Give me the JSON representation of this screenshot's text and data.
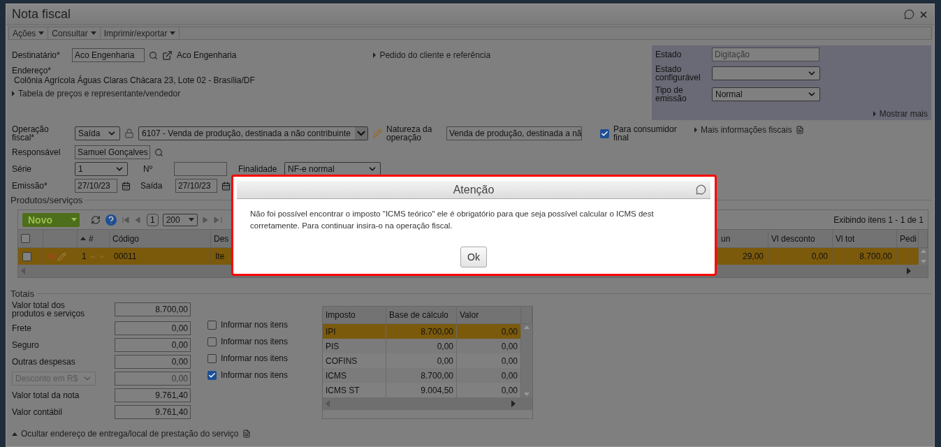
{
  "window": {
    "title": "Nota fiscal"
  },
  "menu": [
    {
      "label": "Ações"
    },
    {
      "label": "Consultar"
    },
    {
      "label": "Imprimir/exportar"
    }
  ],
  "destinatario": {
    "label": "Destinatário*",
    "value": "Aco Engenharia",
    "link": "Aco Engenharia"
  },
  "pedido_link": "Pedido do cliente e referência",
  "endereco": {
    "label": "Endereço*",
    "value": "Colônia Agrícola Águas Claras Chácara 23, Lote 02 - Brasília/DF"
  },
  "tabela_link": "Tabela de preços e representante/vendedor",
  "status_panel": {
    "estado": {
      "label": "Estado",
      "value": "Digitação"
    },
    "estado_configuravel": {
      "label": "Estado configurável"
    },
    "tipo_emissao": {
      "label": "Tipo de emissão",
      "value": "Normal"
    },
    "more_link": "Mostrar mais"
  },
  "operacao": {
    "label": "Operação fiscal*",
    "type": "Saída",
    "value": "6107 - Venda de produção, destinada a não contribuinte",
    "natureza_label": "Natureza da operação",
    "natureza_value": "Venda de produção, destinada a nã",
    "consumidor": {
      "label": "Para consumidor final",
      "checked": true
    },
    "info_link": "Mais informações fiscais"
  },
  "responsavel": {
    "label": "Responsável",
    "value": "Samuel Gonçalves"
  },
  "serie": {
    "label": "Série",
    "value": "1",
    "numero_label": "Nº",
    "finalidade_label": "Finalidade",
    "finalidade_value": "NF-e normal"
  },
  "emissao": {
    "label": "Emissão*",
    "value": "27/10/23",
    "saida_label": "Saída",
    "saida_value": "27/10/23"
  },
  "produtos": {
    "legend": "Produtos/serviços",
    "new_button": "Novo",
    "page": "1",
    "page_size": "200",
    "summary": "Exibindo itens 1 - 1 de 1",
    "columns": [
      "#",
      "Código",
      "Des",
      "un",
      "Vl desconto",
      "Vl tot",
      "Pedi"
    ],
    "header_checked": false,
    "rows": [
      {
        "selected": true,
        "checked": false,
        "cells": [
          "1",
          "00011",
          "Ite",
          "29,00",
          "0,00",
          "8.700,00"
        ]
      }
    ]
  },
  "totais": {
    "legend": "Totais",
    "rows": [
      {
        "kind": "field",
        "label": "Valor total dos produtos e serviços",
        "value": "8.700,00"
      },
      {
        "kind": "field",
        "label": "Frete",
        "value": "0,00",
        "option": {
          "label": "Informar nos itens",
          "checked": false
        }
      },
      {
        "kind": "field",
        "label": "Seguro",
        "value": "0,00",
        "option": {
          "label": "Informar nos itens",
          "checked": false
        }
      },
      {
        "kind": "field",
        "label": "Outras despesas",
        "value": "0,00",
        "option": {
          "label": "Informar nos itens",
          "checked": false
        }
      },
      {
        "kind": "select",
        "label": "Desconto em R$",
        "value": "0,00",
        "option": {
          "label": "Informar nos itens",
          "checked": true
        }
      },
      {
        "kind": "field",
        "label": "Valor total da nota",
        "value": "9.761,40"
      },
      {
        "kind": "field",
        "label": "Valor contábil",
        "value": "9.761,40"
      }
    ],
    "taxes": {
      "columns": [
        "Imposto",
        "Base de cálculo",
        "Valor"
      ],
      "rows": [
        {
          "selected": true,
          "cells": [
            "IPI",
            "8.700,00",
            "0,00"
          ]
        },
        {
          "selected": false,
          "cells": [
            "PIS",
            "0,00",
            "0,00"
          ]
        },
        {
          "selected": false,
          "cells": [
            "COFINS",
            "0,00",
            "0,00"
          ]
        },
        {
          "selected": false,
          "cells": [
            "ICMS",
            "8.700,00",
            "0,00"
          ]
        },
        {
          "selected": false,
          "cells": [
            "ICMS ST",
            "9.004,50",
            "0,00"
          ]
        }
      ]
    }
  },
  "footer_link": "Ocultar endereço de entrega/local de prestação do serviço",
  "dialog": {
    "title": "Atenção",
    "message": "Não foi possível encontrar o imposto \"ICMS teórico\" ele é obrigatório para que seja possível calcular o ICMS dest corretamente. Para continuar insira-o na operação fiscal.",
    "button": "Ok"
  }
}
